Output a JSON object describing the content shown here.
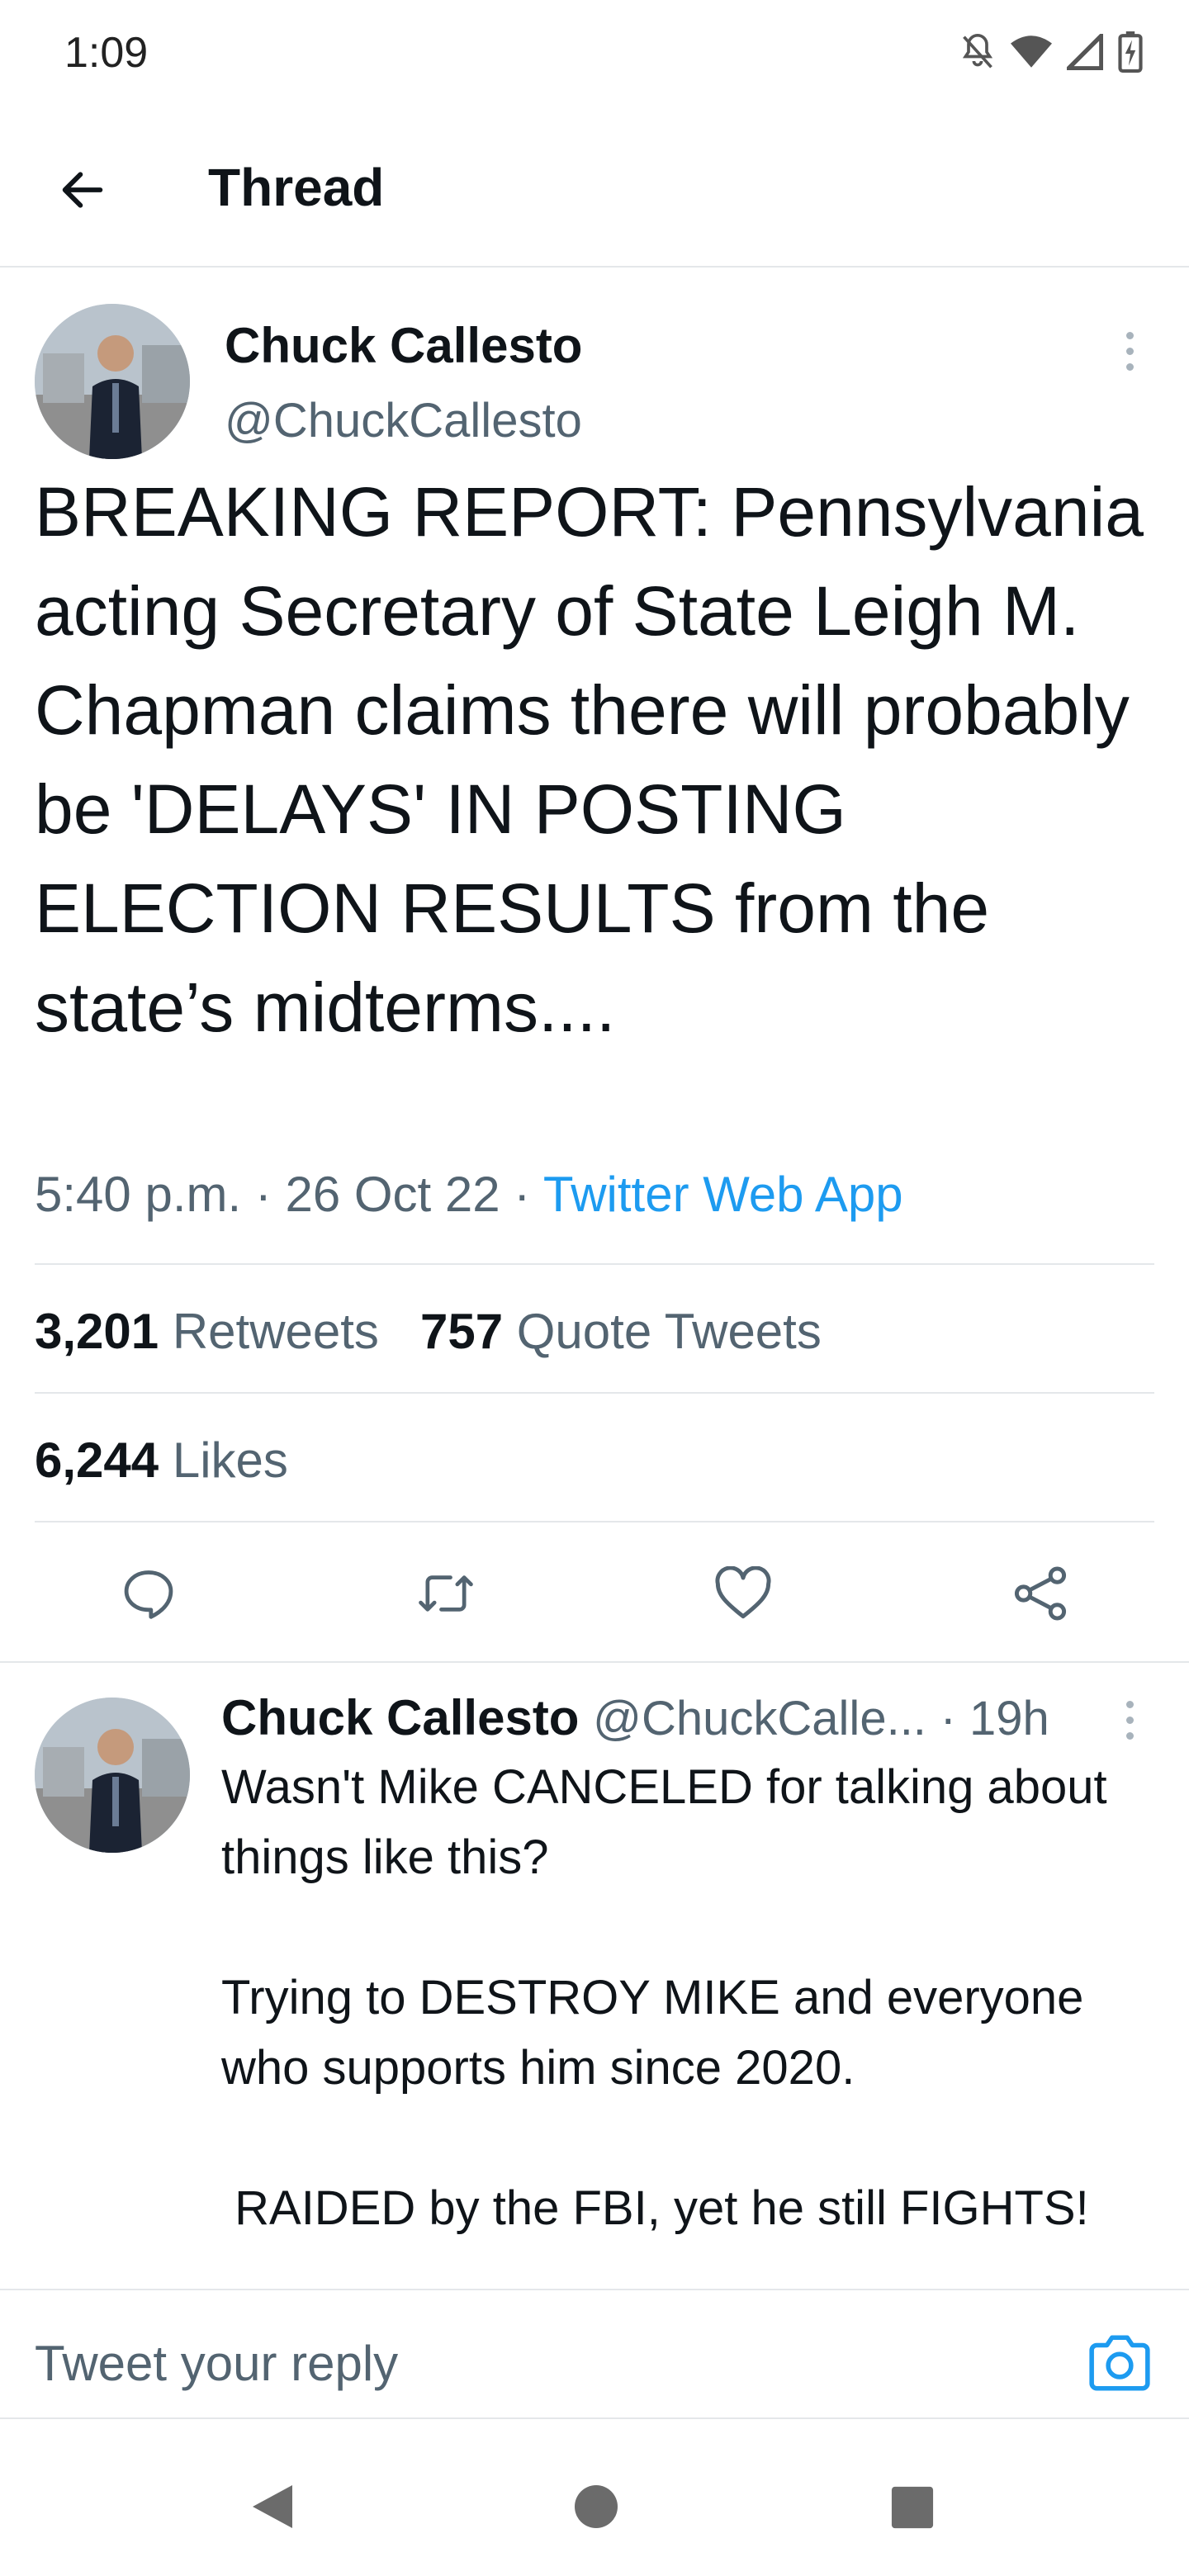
{
  "status_bar": {
    "time": "1:09",
    "icons": [
      "bell-off-icon",
      "wifi-icon",
      "signal-icon",
      "battery-charging-icon"
    ]
  },
  "header": {
    "back_icon": "arrow-left-icon",
    "title": "Thread"
  },
  "main_tweet": {
    "author_name": "Chuck Callesto",
    "author_handle": "@ChuckCallesto",
    "text": "BREAKING REPORT: Pennsylvania acting Secretary of State Leigh M. Chapman claims there will probably be 'DELAYS' IN POSTING ELECTION RESULTS from the state’s midterms....",
    "time": "5:40 p.m.",
    "date": "26 Oct 22",
    "source": "Twitter Web App",
    "retweets_count": "3,201",
    "retweets_label": "Retweets",
    "quotes_count": "757",
    "quotes_label": "Quote Tweets",
    "likes_count": "6,244",
    "likes_label": "Likes",
    "actions": [
      "reply-icon",
      "retweet-icon",
      "like-icon",
      "share-icon"
    ]
  },
  "reply_tweet": {
    "author_name": "Chuck Callesto",
    "author_handle": "@ChuckCalle...",
    "age": "· 19h",
    "text": "Wasn't Mike CANCELED for talking about things like this?\n\nTrying to DESTROY MIKE and everyone who supports him since 2020.\n\n RAIDED by the FBI, yet he still FIGHTS!"
  },
  "compose": {
    "placeholder": "Tweet your reply",
    "camera_icon": "camera-icon"
  },
  "nav_bar": {
    "icons": [
      "back-triangle-icon",
      "home-circle-icon",
      "recents-square-icon"
    ]
  },
  "colors": {
    "accent": "#1d9bf0",
    "text_primary": "#0f1419",
    "text_secondary": "#536471",
    "divider": "#e4e7ea"
  }
}
